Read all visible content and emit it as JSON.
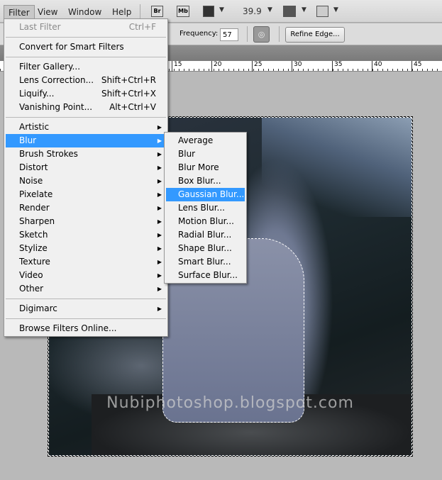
{
  "menubar": {
    "items": [
      "Filter",
      "View",
      "Window",
      "Help"
    ],
    "icons": {
      "bridge": "Br",
      "mini_bridge": "Mb"
    },
    "zoom": "39.9"
  },
  "options": {
    "frequency_label": "Frequency:",
    "frequency_value": "57",
    "refine_edge": "Refine Edge..."
  },
  "ruler": [
    "15",
    "20",
    "25",
    "30",
    "35",
    "40",
    "45"
  ],
  "filter_menu": {
    "last_filter": {
      "label": "Last Filter",
      "shortcut": "Ctrl+F"
    },
    "convert": "Convert for Smart Filters",
    "group1": [
      {
        "label": "Filter Gallery...",
        "shortcut": ""
      },
      {
        "label": "Lens Correction...",
        "shortcut": "Shift+Ctrl+R"
      },
      {
        "label": "Liquify...",
        "shortcut": "Shift+Ctrl+X"
      },
      {
        "label": "Vanishing Point...",
        "shortcut": "Alt+Ctrl+V"
      }
    ],
    "submenus": [
      "Artistic",
      "Blur",
      "Brush Strokes",
      "Distort",
      "Noise",
      "Pixelate",
      "Render",
      "Sharpen",
      "Sketch",
      "Stylize",
      "Texture",
      "Video",
      "Other"
    ],
    "digimarc": "Digimarc",
    "browse": "Browse Filters Online..."
  },
  "blur_submenu": [
    "Average",
    "Blur",
    "Blur More",
    "Box Blur...",
    "Gaussian Blur...",
    "Lens Blur...",
    "Motion Blur...",
    "Radial Blur...",
    "Shape Blur...",
    "Smart Blur...",
    "Surface Blur..."
  ],
  "highlight_color": "#3399ff",
  "watermark": "Nubiphotoshop.blogspot.com"
}
